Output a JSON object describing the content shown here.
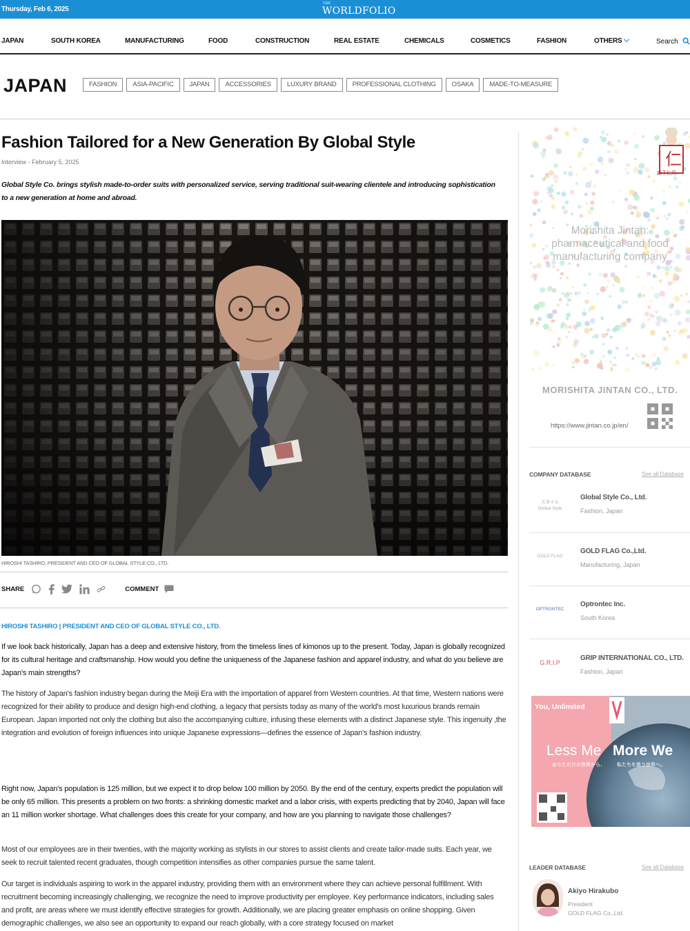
{
  "topbar": {
    "date": "Thursday, Feb 6, 2025",
    "logo_small": "THE",
    "logo_name": "WORLDFOLIO"
  },
  "nav": {
    "items": [
      "JAPAN",
      "SOUTH KOREA",
      "MANUFACTURING",
      "FOOD",
      "CONSTRUCTION",
      "REAL ESTATE",
      "CHEMICALS",
      "COSMETICS",
      "FASHION",
      "OTHERS"
    ],
    "search_label": "Search",
    "accent": "#1b8fd6"
  },
  "section": {
    "title": "JAPAN",
    "tags": [
      "FASHION",
      "ASIA-PACIFIC",
      "JAPAN",
      "ACCESSORIES",
      "LUXURY BRAND",
      "PROFESSIONAL CLOTHING",
      "OSAKA",
      "MADE-TO-MEASURE"
    ]
  },
  "article": {
    "headline": "Fashion Tailored for a New Generation By Global Style",
    "byline": "Interview - February 5, 2025",
    "lede": "Global Style Co. brings stylish made-to-order suits with personalized service, serving traditional suit-wearing clientele and introducing sophistication to a new generation at home and abroad.",
    "caption": "HIROSHI TASHIRO, PRESIDENT AND CEO OF GLOBAL STYLE CO., LTD.",
    "share_label": "SHARE",
    "comment_label": "COMMENT",
    "author": "HIROSHI TASHIRO | PRESIDENT AND CEO OF GLOBAL STYLE CO., LTD.",
    "q1": "If we look back historically, Japan has a deep and extensive history, from the timeless lines of kimonos up to the present. Today, Japan is globally recognized for its cultural heritage and craftsmanship. How would you define the uniqueness of the Japanese fashion and apparel industry, and what do you believe are Japan's main strengths?",
    "a1": "The history of Japan's fashion industry began during the Meiji Era with the importation of apparel from Western countries. At that time, Western nations were recognized for their ability to produce and design high-end clothing, a legacy that persists today as many of the world's most luxurious brands remain European. Japan imported not only the clothing but also the accompanying culture, infusing these elements with a distinct Japanese style. This ingenuity ,the integration and evolution of foreign influences into unique Japanese expressions—defines the essence of Japan's fashion industry.",
    "q2": "Right now, Japan's population is 125 million, but we expect it to drop below 100 million by 2050. By the end of the century, experts predict the population will be only 65 million. This presents a problem on two fronts: a shrinking domestic market and a labor crisis, with experts predicting that by 2040, Japan will face an 11 million worker shortage. What challenges does this create for your company, and how are you planning to navigate those challenges?",
    "a2": "Most of our employees are in their twenties, with the majority working as stylists in our stores to assist clients and create tailor-made suits. Each year, we seek to recruit talented recent graduates, though competition intensifies as other companies pursue the same talent.",
    "a3": "Our target is individuals aspiring to work in the apparel industry, providing them with an environment where they can achieve personal fulfillment. With recruitment becoming increasingly challenging, we recognize the need to improve productivity per employee. Key performance indicators, including sales and profit, are areas where we must identify effective strategies for growth. Additionally, we are placing greater emphasis on online shopping. Given demographic challenges, we also see an opportunity to expand our reach globally, with a core strategy focused on market"
  },
  "sidebar": {
    "ad1": {
      "line1": "Morishita Jintan:",
      "line2": "pharmaceutical and food",
      "line3": "manufacturing company",
      "company": "MORISHITA JINTAN CO., LTD.",
      "url": "https://www.jintan.co.jp/en/",
      "stamp_char": "仁",
      "stamp_text": "森下仁丹"
    },
    "company_db": {
      "heading": "COMPANY DATABASE",
      "see_all": "See all Database",
      "items": [
        {
          "logo": "スタイル\nGlobal Style",
          "name": "Global Style Co., Ltd.",
          "sub": "Fashion, Japan"
        },
        {
          "logo": "GOLD FLAG",
          "name": "GOLD FLAG Co.,Ltd.",
          "sub": "Manufacturing, Japan"
        },
        {
          "logo": "OPTRONTEC",
          "name": "Optrontec Inc.",
          "sub": "South Korea"
        },
        {
          "logo": "G.R.I.P",
          "name": "GRIP INTERNATIONAL CO., LTD.",
          "sub": "Fashion, Japan"
        }
      ]
    },
    "ad2": {
      "tag": "You, Unlimited",
      "left": "Less Me",
      "right": "More We",
      "left_jp": "あなただけの世界から、",
      "right_jp": "私たちを救う世界へ。"
    },
    "leader_db": {
      "heading": "LEADER DATABASE",
      "see_all": "See all Database",
      "name": "Akiyo Hirakubo",
      "role": "President",
      "company": "GOLD FLAG Co.,Ltd."
    }
  }
}
